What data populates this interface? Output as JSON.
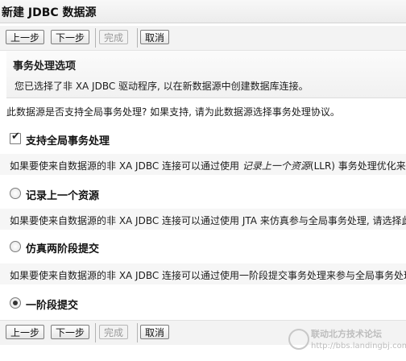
{
  "window": {
    "title": "新建 JDBC 数据源"
  },
  "toolbar": {
    "prev_label": "上一步",
    "next_label": "下一步",
    "finish_label": "完成",
    "cancel_label": "取消"
  },
  "section": {
    "title": "事务处理选项",
    "description": "您已选择了非 XA JDBC 驱动程序, 以在新数据源中创建数据库连接。"
  },
  "question": "此数据源是否支持全局事务处理? 如果支持, 请为此数据源选择事务处理协议。",
  "global_tx": {
    "label": "支持全局事务处理",
    "checked": true
  },
  "descriptions": {
    "llr_prefix": "如果要使来自数据源的非 XA JDBC 连接可以通过使用 ",
    "llr_emphasis": "记录上一个资源",
    "llr_suffix": "(LLR) 事务处理优化来参",
    "emulate": "如果要使来自数据源的非 XA JDBC 连接可以通过使用 JTA 来仿真参与全局事务处理, 请选择此",
    "one_phase": "如果要使来自数据源的非 XA JDBC 连接可以通过使用一阶段提交事务处理来参与全局事务处理"
  },
  "options": [
    {
      "label": "记录上一个资源",
      "selected": false
    },
    {
      "label": "仿真两阶段提交",
      "selected": false
    },
    {
      "label": "一阶段提交",
      "selected": true
    }
  ],
  "watermark": {
    "name": "联动北方技术论坛",
    "url": "http://bbs.landingbj.com"
  }
}
